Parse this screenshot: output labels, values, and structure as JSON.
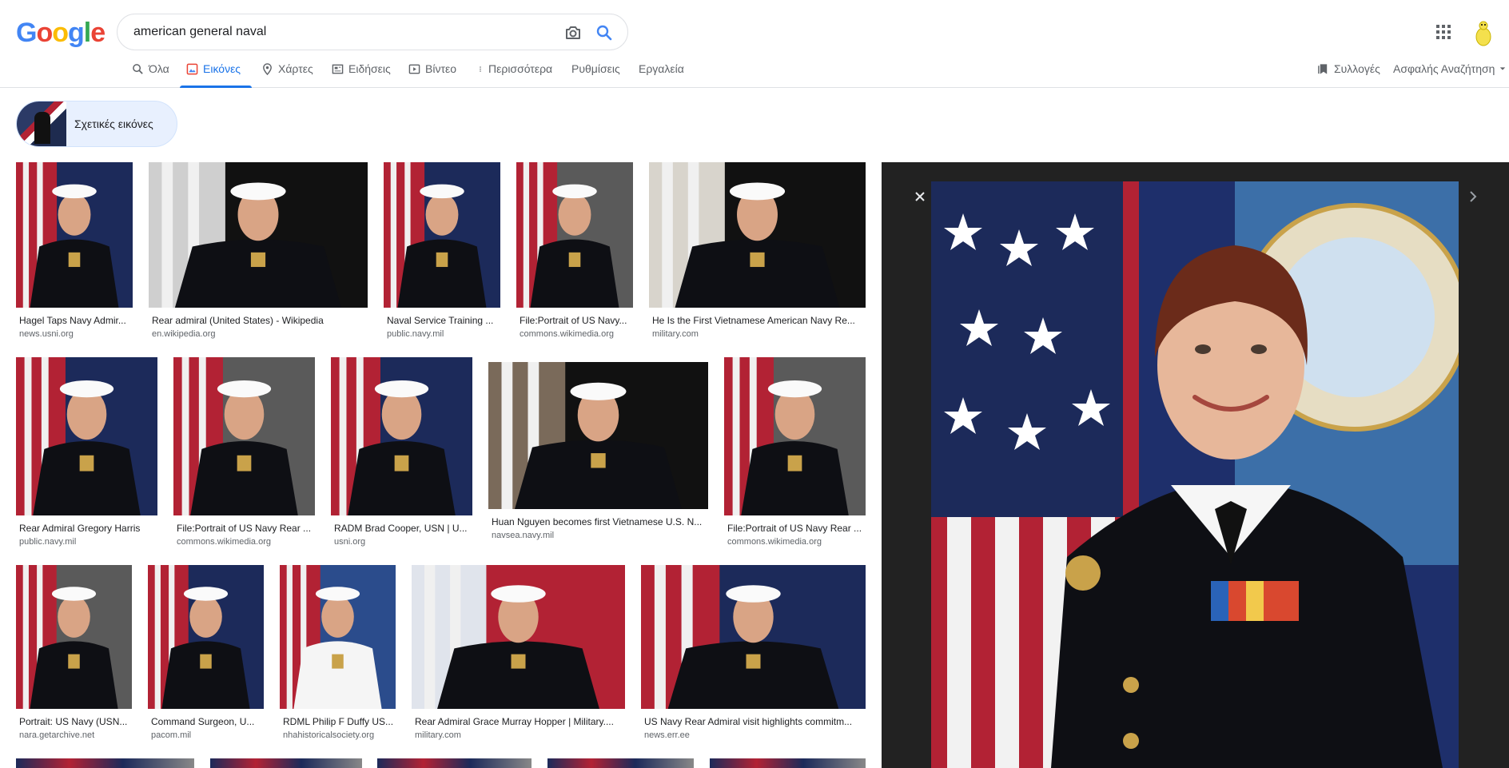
{
  "header": {
    "logo_letters": [
      "G",
      "o",
      "o",
      "g",
      "l",
      "e"
    ],
    "logo_colors": [
      "#4285F4",
      "#EA4335",
      "#FBBC05",
      "#4285F4",
      "#34A853",
      "#EA4335"
    ],
    "search_value": "american general naval",
    "search_icon": "search-icon",
    "camera_icon": "camera-icon",
    "apps_icon": "apps-grid-icon"
  },
  "tabs": {
    "all": "Όλα",
    "images": "Εικόνες",
    "maps": "Χάρτες",
    "news": "Ειδήσεις",
    "videos": "Βίντεο",
    "more": "Περισσότερα",
    "settings": "Ρυθμίσεις",
    "tools": "Εργαλεία"
  },
  "right_tools": {
    "collections": "Συλλογές",
    "safe_search": "Ασφαλής Αναζήτηση"
  },
  "related": {
    "label": "Σχετικές εικόνες"
  },
  "results": [
    {
      "title": "Hagel Taps Navy Admir...",
      "source": "news.usni.org"
    },
    {
      "title": "Rear admiral (United States) - Wikipedia",
      "source": "en.wikipedia.org"
    },
    {
      "title": "Naval Service Training ...",
      "source": "public.navy.mil"
    },
    {
      "title": "File:Portrait of US Navy...",
      "source": "commons.wikimedia.org"
    },
    {
      "title": "He Is the First Vietnamese American Navy Re...",
      "source": "military.com"
    },
    {
      "title": "Rear Admiral Gregory Harris",
      "source": "public.navy.mil"
    },
    {
      "title": "File:Portrait of US Navy Rear ...",
      "source": "commons.wikimedia.org"
    },
    {
      "title": "RADM Brad Cooper, USN | U...",
      "source": "usni.org"
    },
    {
      "title": "Huan Nguyen becomes first Vietnamese U.S. N...",
      "source": "navsea.navy.mil"
    },
    {
      "title": "File:Portrait of US Navy Rear ...",
      "source": "commons.wikimedia.org"
    },
    {
      "title": "Portrait: US Navy (USN...",
      "source": "nara.getarchive.net"
    },
    {
      "title": "Command Surgeon, U...",
      "source": "pacom.mil"
    },
    {
      "title": "RDML Philip F Duffy US...",
      "source": "nhahistoricalsociety.org"
    },
    {
      "title": "Rear Admiral Grace Murray Hopper | Military....",
      "source": "military.com"
    },
    {
      "title": "US Navy Rear Admiral visit highlights commitm...",
      "source": "news.err.ee"
    }
  ],
  "colors": {
    "accent": "#1a73e8",
    "preview_bg": "#222222",
    "navy": "#1e2b4f",
    "flag_red": "#b22234"
  }
}
